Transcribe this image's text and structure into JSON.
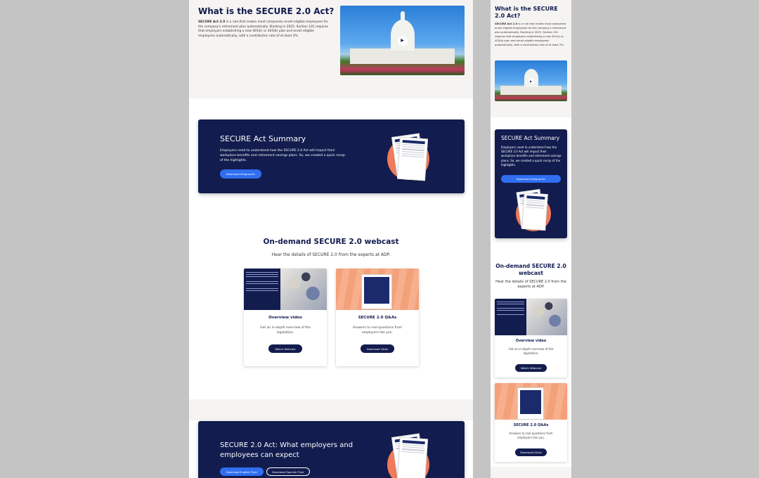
{
  "hero": {
    "title": "What is the SECURE 2.0 Act?",
    "body_bold": "SECURE Act 2.0",
    "body": " is a rule that makes most companies enroll eligible employees for the company's retirement plan automatically. Starting in 2025, Section 101 requires that employers establishing a new 401(k) or 403(b) plan and enroll eligible employees automatically, with a contribution rate of at least 3%.",
    "play_icon": "play-icon"
  },
  "summary": {
    "title": "SECURE Act Summary",
    "body": "Employers need to understand how the SECURE 2.0 Act will impact their workplace benefits and retirement savings plans. So, we created a quick recap of the highlights.",
    "button": "Download Infographic"
  },
  "webcast": {
    "title": "On-demand SECURE 2.0 webcast",
    "subtitle": "Hear the details of SECURE 2.0 from the experts at ADP.",
    "cards": [
      {
        "title": "Overview video",
        "desc": "Get an in-depth overview of the legislation.",
        "button": "Watch Webcast"
      },
      {
        "title": "SECURE 2.0 Q&As",
        "desc": "Answers to real questions from employers like you.",
        "button": "Download Q&As"
      }
    ]
  },
  "flyer": {
    "title": "SECURE 2.0 Act: What employers and employees can expect",
    "button_en": "Download English Flyer",
    "button_es": "Download Spanish Flyer"
  },
  "colors": {
    "navy": "#121c4e",
    "blue": "#2f6ff0",
    "coral": "#f07a5a",
    "gray_bg": "#f5f4f2"
  }
}
